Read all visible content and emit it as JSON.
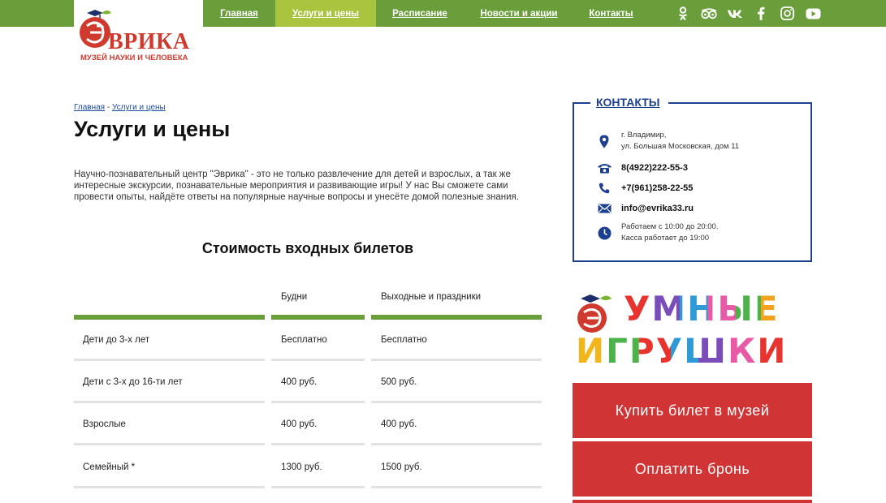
{
  "nav": [
    {
      "label": "Главная",
      "active": false
    },
    {
      "label": "Услуги и цены",
      "active": true
    },
    {
      "label": "Расписание",
      "active": false
    },
    {
      "label": "Новости и акции",
      "active": false
    },
    {
      "label": "Контакты",
      "active": false
    }
  ],
  "social_icons": [
    "odnoklassniki-icon",
    "tripadvisor-icon",
    "vk-icon",
    "facebook-icon",
    "instagram-icon",
    "youtube-icon"
  ],
  "logo": {
    "word": "ВРИКА",
    "letter": "Э",
    "subtitle": "МУЗЕЙ НАУКИ И ЧЕЛОВЕКА"
  },
  "breadcrumb": {
    "home": "Главная",
    "separator": " - ",
    "current": "Услуги и цены"
  },
  "page_title": "Услуги и цены",
  "intro": "Научно-познавательный центр \"Эврика\" - это не только развлечение для детей и взрослых, а так же интересные экскурсии, познавательные мероприятия и развивающие игры! У нас Вы сможете сами провести опыты, найдёте ответы на популярные научные вопросы и унесёте домой полезные знания.",
  "tickets": {
    "title": "Стоимость входных билетов",
    "headers": [
      "",
      "Будни",
      "Выходные и праздники"
    ],
    "rows": [
      [
        "Дети до 3-х лет",
        "Бесплатно",
        "Бесплатно"
      ],
      [
        "Дети с 3-х до 16-ти лет",
        "400 руб.",
        "500 руб."
      ],
      [
        "Взрослые",
        "400 руб.",
        "400 руб."
      ],
      [
        "Семейный *",
        "1300 руб.",
        "1500 руб."
      ]
    ]
  },
  "contacts": {
    "title": "КОНТАКТЫ",
    "address_line1": "г. Владимир,",
    "address_line2": "ул. Большая Московская, дом 11",
    "phone1": "8(4922)222-55-3",
    "phone2": "+7(961)258-22-55",
    "email": "info@evrika33.ru",
    "hours_line1": "Работаем с 10:00 до 20:00.",
    "hours_line2": "Касса работает до 19:00"
  },
  "promo": {
    "line1": "УМНЫЕ",
    "line2": "ИГРУШКИ"
  },
  "buttons": {
    "buy_ticket": "Купить билет в музей",
    "pay_booking": "Оплатить бронь"
  },
  "colors": {
    "green": "#6a9e3a",
    "light_green": "#a9c43e",
    "red": "#d13434",
    "navy": "#1d3f8f"
  }
}
